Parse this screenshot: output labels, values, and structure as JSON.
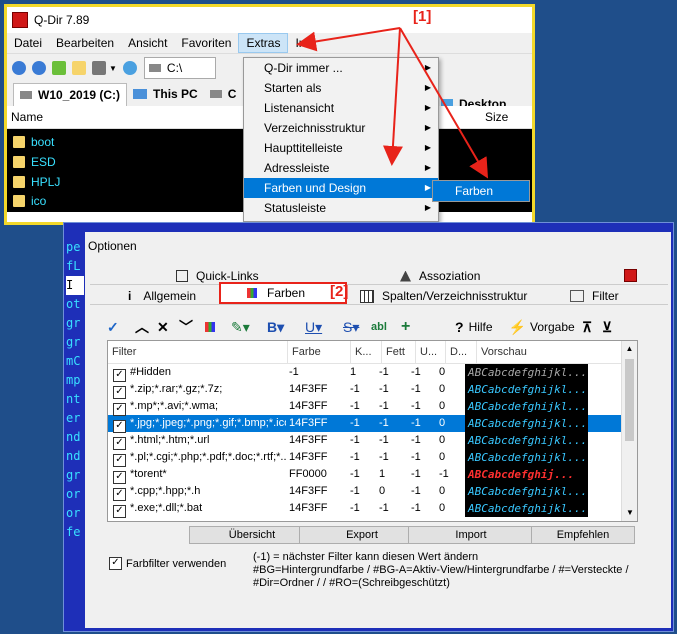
{
  "colors": {
    "preview_blue": "#39c8ff",
    "preview_red": "#ff3030",
    "preview_gray": "#a8a8a8",
    "highlight": "#0078d7",
    "annotation": "#e8231a"
  },
  "qdir": {
    "title": "Q-Dir 7.89",
    "menu": [
      "Datei",
      "Bearbeiten",
      "Ansicht",
      "Favoriten",
      "Extras",
      "Info"
    ],
    "address": "C:\\",
    "tabs": [
      "W10_2019 (C:)",
      "This PC",
      "C",
      "Desktop"
    ],
    "col_name": "Name",
    "col_size": "Size",
    "folders": [
      "boot",
      "ESD",
      "HPLJ",
      "ico"
    ]
  },
  "dropdown": {
    "items": [
      "Q-Dir immer ...",
      "Starten als",
      "Listenansicht",
      "Verzeichnisstruktur",
      "Haupttitelleiste",
      "Adressleiste",
      "Farben und Design",
      "Statusleiste"
    ],
    "submenu_item": "Farben"
  },
  "annotations": {
    "label1": "[1]",
    "label2": "[2]"
  },
  "left_strip": [
    "pe",
    "fL",
    "I",
    "ot",
    "gr",
    "gr",
    "mC",
    "mp",
    "nt",
    "er",
    "nd",
    "nd",
    "gr",
    "or",
    "or",
    "fe"
  ],
  "options": {
    "title": "Optionen",
    "tabs_row1": [
      "Quick-Links",
      "Assoziation"
    ],
    "tabs_row2": [
      "Allgemein",
      "Farben",
      "Spalten/Verzeichnisstruktur",
      "Filter"
    ],
    "toolbar_help": "Hilfe",
    "toolbar_vorgabe": "Vorgabe",
    "columns": [
      "Filter",
      "Farbe",
      "K...",
      "Fett",
      "U...",
      "D...",
      "Vorschau"
    ],
    "rows": [
      {
        "filter": "#Hidden",
        "farbe": "-1",
        "k": "1",
        "fett": "-1",
        "u": "-1",
        "d": "0",
        "preview": "ABCabcdefghijkl...",
        "style": "gray"
      },
      {
        "filter": "*.zip;*.rar;*.gz;*.7z;",
        "farbe": "14F3FF",
        "k": "-1",
        "fett": "-1",
        "u": "-1",
        "d": "0",
        "preview": "ABCabcdefghijkl...",
        "style": "blue"
      },
      {
        "filter": "*.mp*;*.avi;*.wma;",
        "farbe": "14F3FF",
        "k": "-1",
        "fett": "-1",
        "u": "-1",
        "d": "0",
        "preview": "ABCabcdefghijkl...",
        "style": "blue"
      },
      {
        "filter": "*.jpg;*.jpeg;*.png;*.gif;*.bmp;*.ico",
        "farbe": "14F3FF",
        "k": "-1",
        "fett": "-1",
        "u": "-1",
        "d": "0",
        "preview": "ABCabcdefghijkl...",
        "style": "blue"
      },
      {
        "filter": "*.html;*.htm;*.url",
        "farbe": "14F3FF",
        "k": "-1",
        "fett": "-1",
        "u": "-1",
        "d": "0",
        "preview": "ABCabcdefghijkl...",
        "style": "blue"
      },
      {
        "filter": "*.pl;*.cgi;*.php;*.pdf;*.doc;*.rtf;*...",
        "farbe": "14F3FF",
        "k": "-1",
        "fett": "-1",
        "u": "-1",
        "d": "0",
        "preview": "ABCabcdefghijkl...",
        "style": "blue"
      },
      {
        "filter": "*torent*",
        "farbe": "FF0000",
        "k": "-1",
        "fett": "1",
        "u": "-1",
        "d": "-1",
        "preview": "ABCabcdefghij...",
        "style": "red"
      },
      {
        "filter": "*.cpp;*.hpp;*.h",
        "farbe": "14F3FF",
        "k": "-1",
        "fett": "0",
        "u": "-1",
        "d": "0",
        "preview": "ABCabcdefghijkl...",
        "style": "blue"
      },
      {
        "filter": "*.exe;*.dll;*.bat",
        "farbe": "14F3FF",
        "k": "-1",
        "fett": "-1",
        "u": "-1",
        "d": "0",
        "preview": "ABCabcdefghijkl...",
        "style": "blue"
      }
    ],
    "buttons": [
      "Übersicht",
      "Export",
      "Import",
      "Empfehlen"
    ],
    "checkbox_label": "Farbfilter verwenden",
    "note_line1": "(-1) = nächster Filter kann diesen Wert ändern",
    "note_line2": "#BG=Hintergrundfarbe / #BG-A=Aktiv-View/Hintergrundfarbe / #=Versteckte /",
    "note_line3": "#Dir=Ordner / / #RO=(Schreibgeschützt)"
  }
}
